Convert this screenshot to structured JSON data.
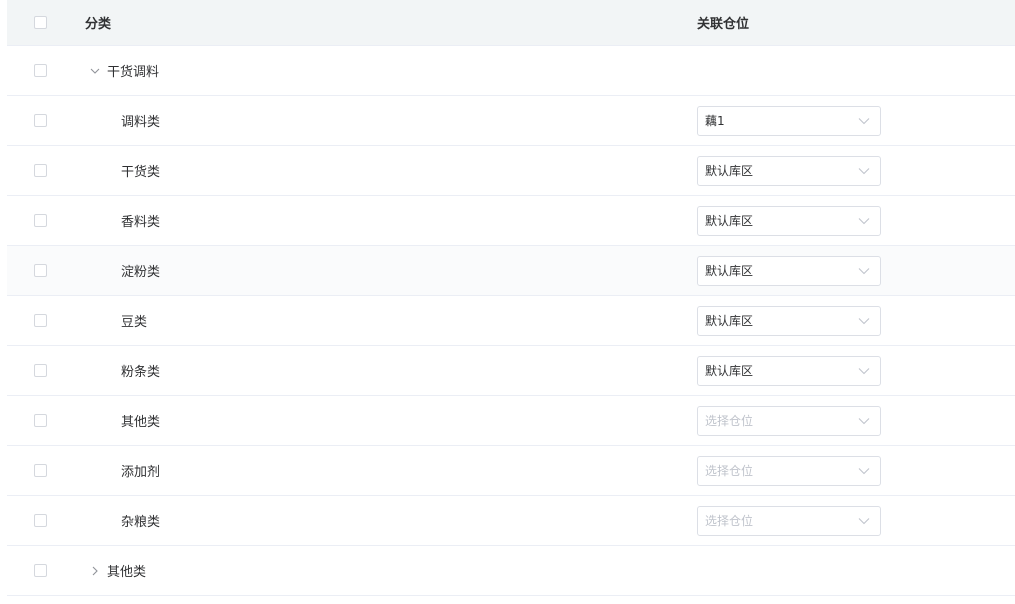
{
  "header": {
    "col_category": "分类",
    "col_location": "关联仓位"
  },
  "rows": [
    {
      "level": 0,
      "expanded": true,
      "name": "干货调料",
      "location": null
    },
    {
      "level": 1,
      "name": "调料类",
      "location": "藕1",
      "placeholder": false
    },
    {
      "level": 1,
      "name": "干货类",
      "location": "默认库区",
      "placeholder": false
    },
    {
      "level": 1,
      "name": "香料类",
      "location": "默认库区",
      "placeholder": false
    },
    {
      "level": 1,
      "name": "淀粉类",
      "location": "默认库区",
      "placeholder": false
    },
    {
      "level": 1,
      "name": "豆类",
      "location": "默认库区",
      "placeholder": false
    },
    {
      "level": 1,
      "name": "粉条类",
      "location": "默认库区",
      "placeholder": false
    },
    {
      "level": 1,
      "name": "其他类",
      "location": "选择仓位",
      "placeholder": true
    },
    {
      "level": 1,
      "name": "添加剂",
      "location": "选择仓位",
      "placeholder": true
    },
    {
      "level": 1,
      "name": "杂粮类",
      "location": "选择仓位",
      "placeholder": true
    },
    {
      "level": 0,
      "expanded": false,
      "name": "其他类",
      "location": null
    }
  ],
  "colors": {
    "border": "#ebeef5",
    "header_bg": "#f2f5f6",
    "placeholder_text": "#c0c4cc"
  },
  "icons": {
    "expanded": "chevron-down-icon",
    "collapsed": "chevron-right-icon",
    "select": "chevron-down-icon"
  }
}
